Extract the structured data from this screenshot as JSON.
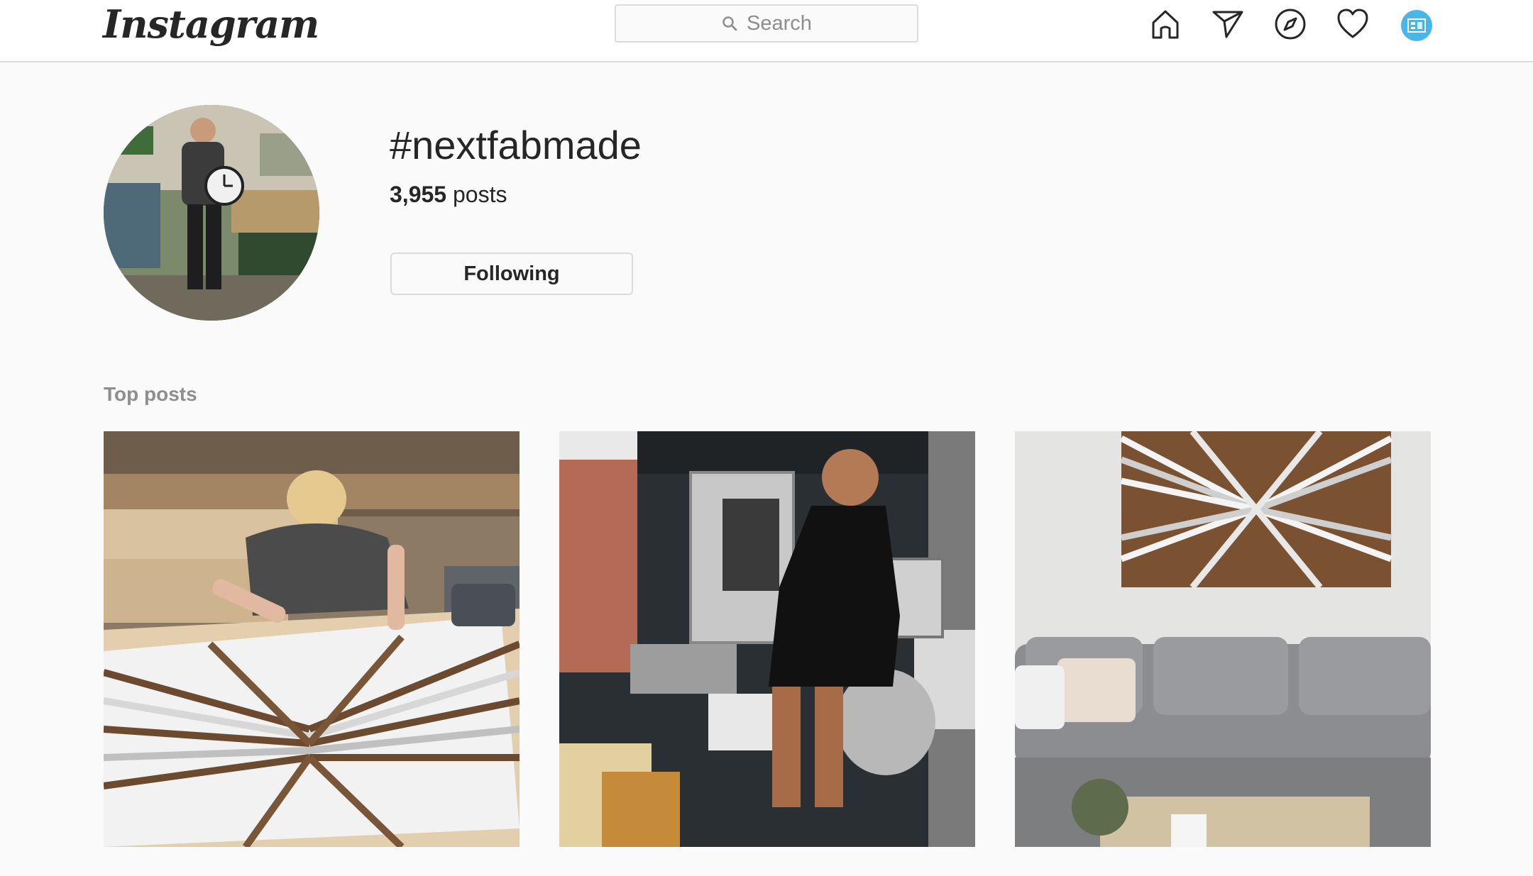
{
  "nav": {
    "logo": "Instagram",
    "search_placeholder": "Search",
    "icons": [
      "home-icon",
      "direct-icon",
      "explore-icon",
      "activity-icon",
      "profile-avatar"
    ]
  },
  "header": {
    "hashtag": "#nextfabmade",
    "post_count": "3,955",
    "post_label": "posts",
    "following_label": "Following"
  },
  "top_posts": {
    "title": "Top posts",
    "items": [
      {
        "depicts": "person-arranging-wood-art-panel"
      },
      {
        "depicts": "woman-in-kitchen-with-mixer"
      },
      {
        "depicts": "wood-art-above-grey-sofa"
      }
    ]
  },
  "colors": {
    "background": "#fafafa",
    "border": "#dbdbdb",
    "text": "#262626",
    "muted": "#8e8e8e"
  }
}
